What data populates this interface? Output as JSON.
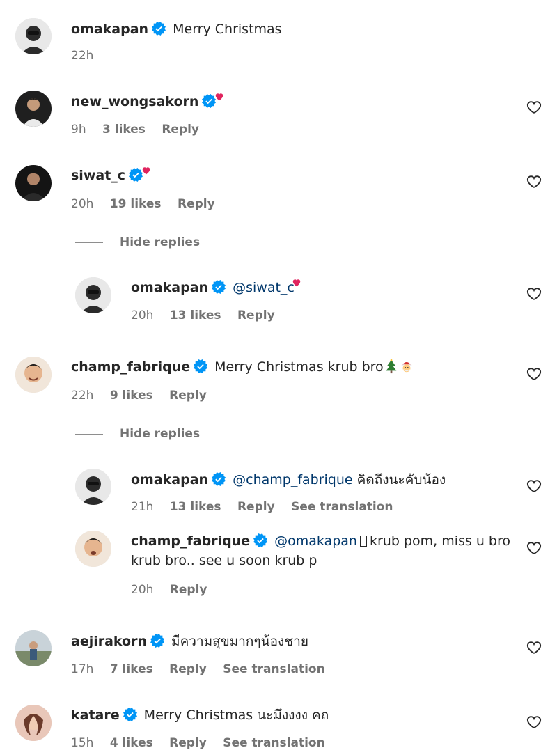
{
  "comments": [
    {
      "username": "omakapan",
      "text": "Merry Christmas",
      "time": "22h"
    },
    {
      "username": "new_wongsakorn",
      "time": "9h",
      "likes": "3 likes",
      "reply": "Reply"
    },
    {
      "username": "siwat_c",
      "time": "20h",
      "likes": "19 likes",
      "reply": "Reply",
      "hide_replies": "Hide replies"
    },
    {
      "username": "omakapan",
      "mention": "@siwat_c",
      "time": "20h",
      "likes": "13 likes",
      "reply": "Reply"
    },
    {
      "username": "champ_fabrique",
      "text": "Merry Christmas krub bro",
      "time": "22h",
      "likes": "9 likes",
      "reply": "Reply",
      "hide_replies": "Hide replies"
    },
    {
      "username": "omakapan",
      "mention": "@champ_fabrique",
      "text": "คิดถึงนะคับน้อง",
      "time": "21h",
      "likes": "13 likes",
      "reply": "Reply",
      "translation": "See translation"
    },
    {
      "username": "champ_fabrique",
      "mention": "@omakapan",
      "text": "krub pom, miss u bro krub bro.. see u soon krub p",
      "time": "20h",
      "reply": "Reply"
    },
    {
      "username": "aejirakorn",
      "text": "มีความสุขมากๆน้องชาย",
      "time": "17h",
      "likes": "7 likes",
      "reply": "Reply",
      "translation": "See translation"
    },
    {
      "username": "katare",
      "text": "Merry Christmas นะมึงงงง คถ",
      "time": "15h",
      "likes": "4 likes",
      "reply": "Reply",
      "translation": "See translation"
    }
  ],
  "icons": {
    "verified": "verified-badge-icon",
    "like": "heart-outline-icon",
    "heart_emoji": "red-heart-emoji",
    "tree_emoji": "christmas-tree-emoji",
    "santa_emoji": "santa-emoji"
  },
  "colors": {
    "verified": "#0095f6",
    "mention": "#00376b",
    "meta": "#737373",
    "heart_emoji": "#e0245e"
  }
}
